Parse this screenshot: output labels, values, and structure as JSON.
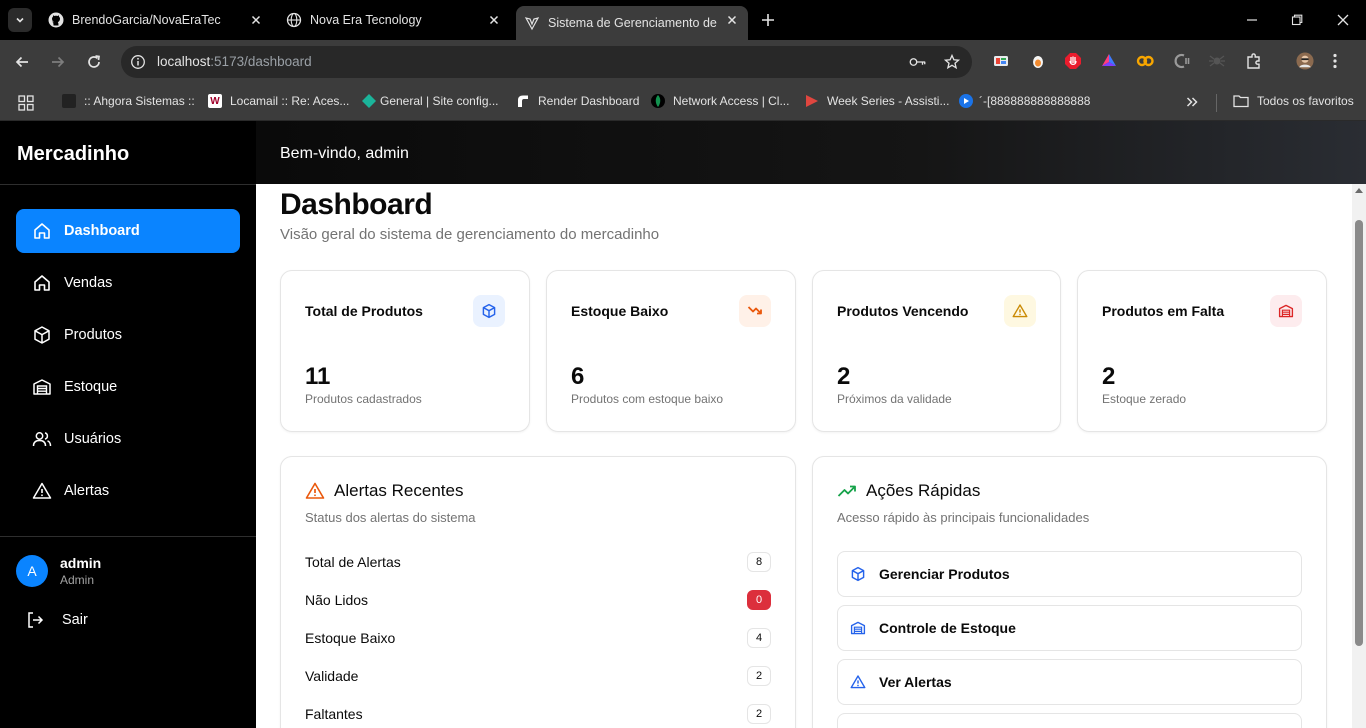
{
  "browser": {
    "tabs": [
      {
        "title": "BrendoGarcia/NovaEraTec"
      },
      {
        "title": "Nova Era Tecnology"
      },
      {
        "title": "Sistema de Gerenciamento de M"
      }
    ],
    "url_host": "localhost",
    "url_path": ":5173/dashboard",
    "bookmarks": [
      {
        "label": ":: Ahgora Sistemas ::"
      },
      {
        "label": "Locamail :: Re: Aces..."
      },
      {
        "label": "General | Site config..."
      },
      {
        "label": "Render Dashboard"
      },
      {
        "label": "Network Access | Cl..."
      },
      {
        "label": "Week Series - Assisti..."
      },
      {
        "label": "´-[888888888888888"
      }
    ],
    "all_bookmarks": "Todos os favoritos"
  },
  "sidebar": {
    "brand": "Mercadinho",
    "items": [
      {
        "label": "Dashboard",
        "icon": "home-icon"
      },
      {
        "label": "Vendas",
        "icon": "home-icon"
      },
      {
        "label": "Produtos",
        "icon": "box-icon"
      },
      {
        "label": "Estoque",
        "icon": "warehouse-icon"
      },
      {
        "label": "Usuários",
        "icon": "users-icon"
      },
      {
        "label": "Alertas",
        "icon": "alert-triangle-icon"
      }
    ],
    "user": {
      "initial": "A",
      "name": "admin",
      "role": "Admin"
    },
    "logout": "Sair"
  },
  "header": {
    "welcome": "Bem-vindo, admin"
  },
  "page": {
    "title": "Dashboard",
    "subtitle": "Visão geral do sistema de gerenciamento do mercadinho"
  },
  "stats": [
    {
      "title": "Total de Produtos",
      "value": "11",
      "desc": "Produtos cadastrados",
      "icon": "box-icon",
      "color": "#2563eb"
    },
    {
      "title": "Estoque Baixo",
      "value": "6",
      "desc": "Produtos com estoque baixo",
      "icon": "trending-down-icon",
      "color": "#ea580c"
    },
    {
      "title": "Produtos Vencendo",
      "value": "2",
      "desc": "Próximos da validade",
      "icon": "alert-triangle-icon",
      "color": "#ca8a04"
    },
    {
      "title": "Produtos em Falta",
      "value": "2",
      "desc": "Estoque zerado",
      "icon": "warehouse-icon",
      "color": "#dc2626"
    }
  ],
  "alerts": {
    "title": "Alertas Recentes",
    "subtitle": "Status dos alertas do sistema",
    "rows": [
      {
        "label": "Total de Alertas",
        "value": "8"
      },
      {
        "label": "Não Lidos",
        "value": "0"
      },
      {
        "label": "Estoque Baixo",
        "value": "4"
      },
      {
        "label": "Validade",
        "value": "2"
      },
      {
        "label": "Faltantes",
        "value": "2"
      }
    ]
  },
  "actions": {
    "title": "Ações Rápidas",
    "subtitle": "Acesso rápido às principais funcionalidades",
    "buttons": [
      {
        "label": "Gerenciar Produtos",
        "icon": "box-icon"
      },
      {
        "label": "Controle de Estoque",
        "icon": "warehouse-icon"
      },
      {
        "label": "Ver Alertas",
        "icon": "alert-triangle-icon"
      }
    ]
  }
}
